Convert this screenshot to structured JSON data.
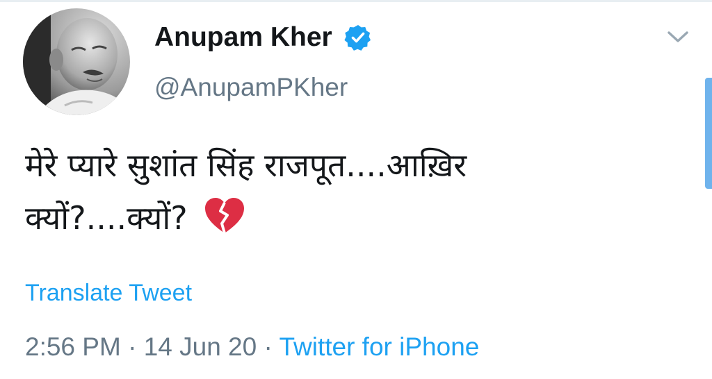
{
  "tweet": {
    "author": {
      "display_name": "Anupam Kher",
      "handle": "@AnupamPKher",
      "verified": true,
      "avatar_icon": "profile-photo"
    },
    "text_lines": [
      "मेरे प्यारे सुशांत सिंह राजपूत....आख़िर",
      "क्यों?....क्यों?"
    ],
    "emoji": "broken-heart-icon",
    "translate_label": "Translate Tweet",
    "time": "2:56 PM",
    "separator": " · ",
    "date": "14 Jun 20",
    "source": "Twitter for iPhone"
  },
  "colors": {
    "text_primary": "#14171a",
    "text_secondary": "#657786",
    "accent": "#1da1f2",
    "broken_heart": "#dd2e44"
  }
}
